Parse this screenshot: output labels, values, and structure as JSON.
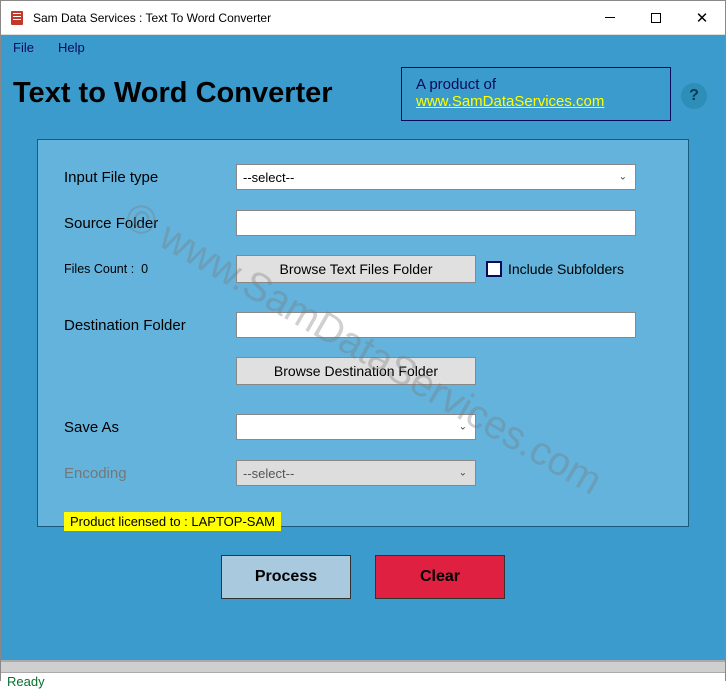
{
  "window": {
    "title": "Sam Data Services : Text To Word Converter"
  },
  "menu": {
    "file": "File",
    "help": "Help"
  },
  "header": {
    "page_title": "Text to Word Converter",
    "product_of": "A product of",
    "product_link": "www.SamDataServices.com",
    "help_tip": "?"
  },
  "form": {
    "input_file_type_label": "Input File type",
    "input_file_type_value": "--select--",
    "source_folder_label": "Source Folder",
    "source_folder_value": "",
    "files_count_label": "Files Count :",
    "files_count_value": "0",
    "browse_source_label": "Browse Text Files Folder",
    "include_subfolders_label": "Include Subfolders",
    "dest_folder_label": "Destination Folder",
    "dest_folder_value": "",
    "browse_dest_label": "Browse Destination Folder",
    "save_as_label": "Save As",
    "save_as_value": "",
    "encoding_label": "Encoding",
    "encoding_value": "--select--",
    "license_label": "Product licensed to : LAPTOP-SAM"
  },
  "actions": {
    "process": "Process",
    "clear": "Clear"
  },
  "status": {
    "ready": "Ready"
  },
  "watermark": "© www.SamDataServices.com"
}
